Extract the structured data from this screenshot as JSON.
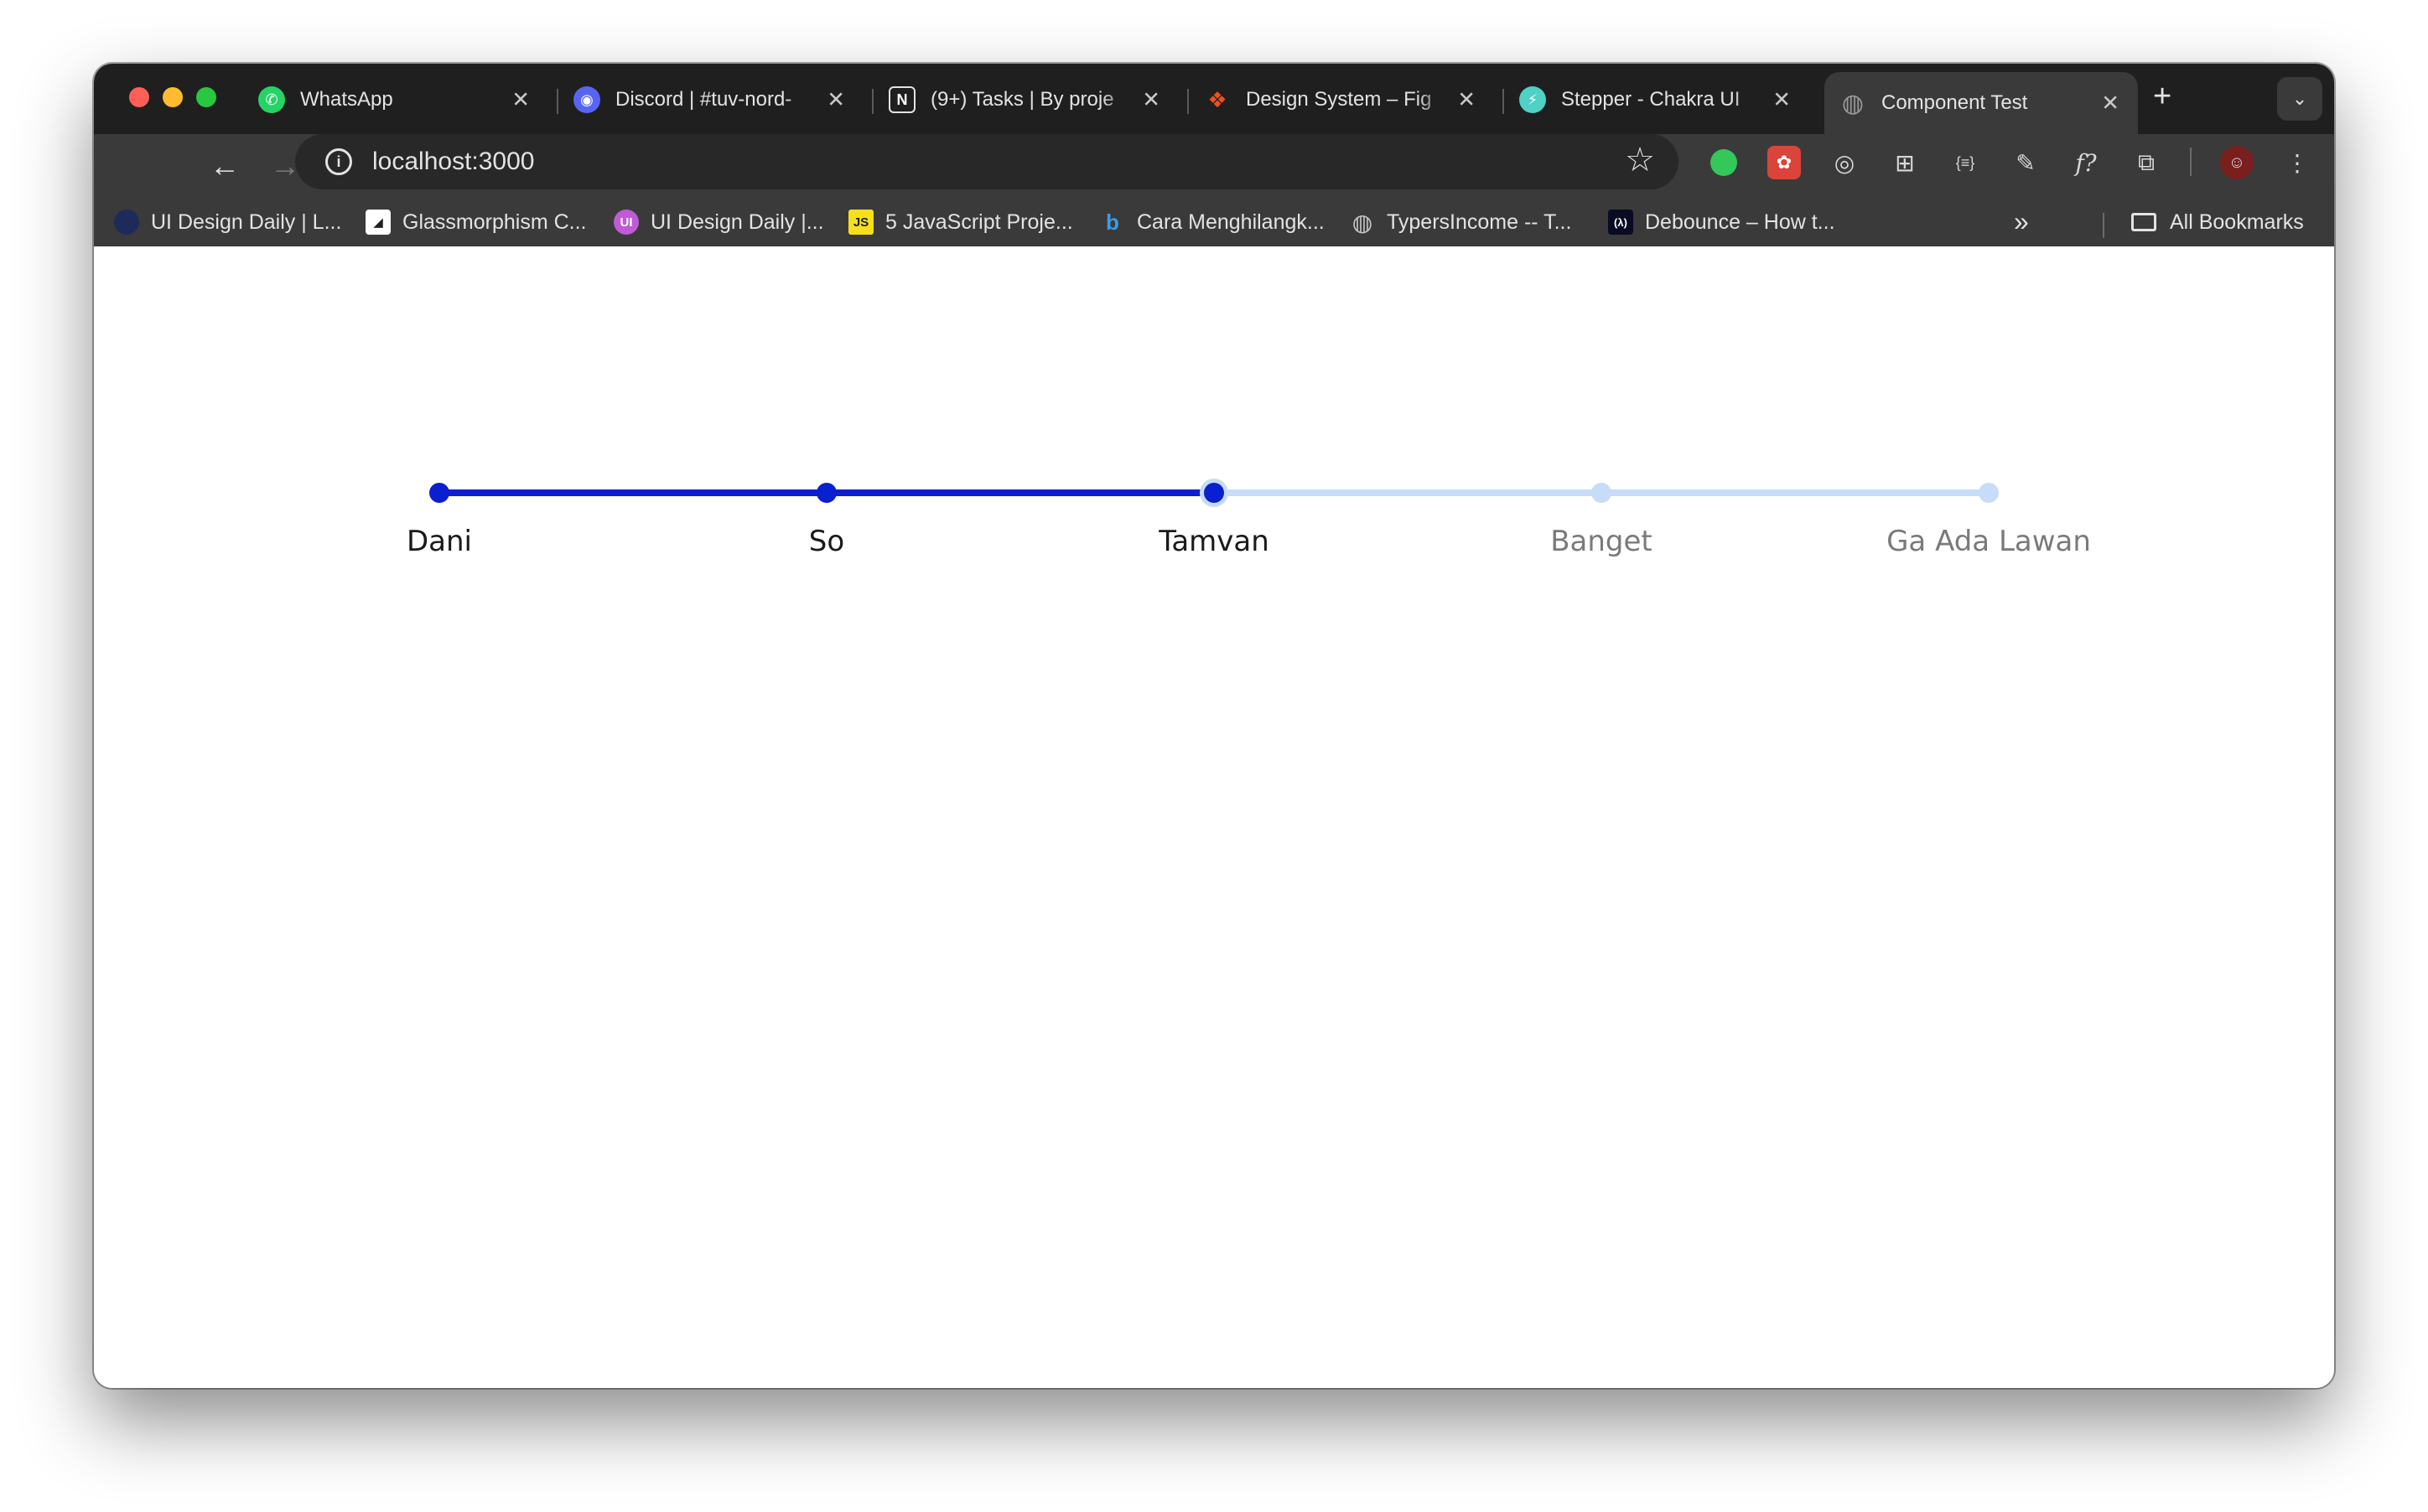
{
  "browser": {
    "tabs": [
      {
        "title": "WhatsApp",
        "icon": "whatsapp-icon",
        "color": "#25d366",
        "glyph": "✆"
      },
      {
        "title": "Discord | #tuv-nord-",
        "icon": "discord-icon",
        "color": "#5865f2",
        "glyph": "◉"
      },
      {
        "title": "(9+) Tasks | By proje",
        "icon": "notion-icon",
        "color": "#1f1f1f",
        "glyph": "N"
      },
      {
        "title": "Design System – Fig",
        "icon": "figma-icon",
        "color": "#1f1f1f",
        "glyph": "❖"
      },
      {
        "title": "Stepper - Chakra UI",
        "icon": "chakra-icon",
        "color": "#4fd1c5",
        "glyph": "⚡"
      },
      {
        "title": "Component Test",
        "icon": "globe-icon",
        "color": "#6b6b6b",
        "glyph": "◍"
      }
    ],
    "active_tab": 5,
    "address": "localhost:3000"
  },
  "bookmarks": [
    {
      "label": "UI Design Daily | L...",
      "icon": "uidesigndaily-icon",
      "color": "#1e2a5a",
      "glyph": ""
    },
    {
      "label": "Glassmorphism C...",
      "icon": "glassmorphism-icon",
      "color": "#ffffff",
      "glyph": "◢"
    },
    {
      "label": "UI Design Daily |...",
      "icon": "uidesigndaily-pink-icon",
      "color": "#c15ad6",
      "glyph": "UI"
    },
    {
      "label": "5 JavaScript Proje...",
      "icon": "javascript-icon",
      "color": "#f7df1e",
      "glyph": "JS"
    },
    {
      "label": "Cara Menghilangk...",
      "icon": "bing-icon",
      "color": "#3a3a3a",
      "glyph": "b"
    },
    {
      "label": "TypersIncome -- T...",
      "icon": "globe-icon",
      "color": "#6b6b6b",
      "glyph": "◍"
    },
    {
      "label": "Debounce – How t...",
      "icon": "freecodecamp-icon",
      "color": "#0a0a23",
      "glyph": "(λ)"
    }
  ],
  "all_bookmarks_label": "All Bookmarks",
  "stepper": {
    "steps": [
      "Dani",
      "So",
      "Tamvan",
      "Banget",
      "Ga Ada Lawan"
    ],
    "active_index": 2,
    "colors": {
      "complete": "#0a1fd0",
      "incomplete": "#c6dcf8",
      "label_active": "#1a1a1a",
      "label_inactive": "#7a7a7a"
    }
  }
}
